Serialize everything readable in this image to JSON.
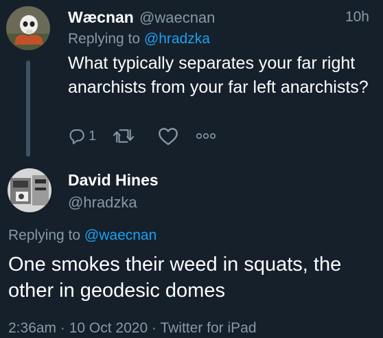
{
  "parent_tweet": {
    "display_name": "Wæcnan",
    "handle": "@waecnan",
    "time": "10h",
    "replying_prefix": "Replying to",
    "replying_to": "@hradzka",
    "text": "What typically separates your far right anarchists from your far left anarchists?",
    "reply_count": "1",
    "icons": [
      "reply-icon",
      "retweet-icon",
      "like-icon",
      "more-icon"
    ]
  },
  "reply_tweet": {
    "display_name": "David Hines",
    "handle": "@hradzka",
    "replying_prefix": "Replying to",
    "replying_to": "@waecnan",
    "text": "One smokes their weed in squats, the other in geodesic domes",
    "time": "2:36am",
    "date": "10 Oct 2020",
    "source": "Twitter for iPad",
    "separator": "·"
  },
  "colors": {
    "background": "#15202b",
    "text_primary": "#ffffff",
    "text_secondary": "#8899a6",
    "link": "#1da1f2",
    "thread_line": "#3d5466"
  }
}
